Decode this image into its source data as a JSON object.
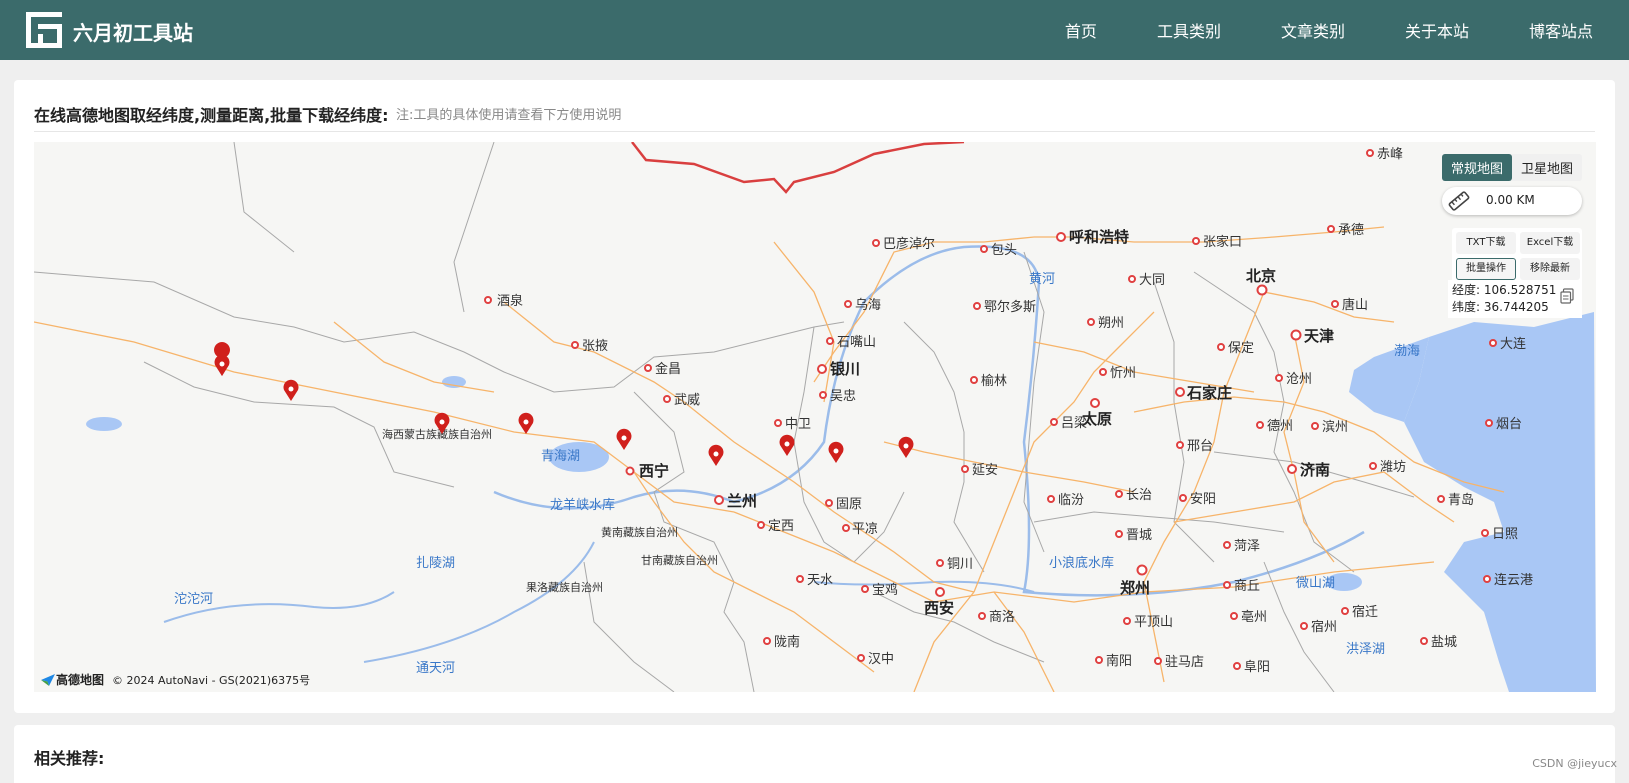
{
  "header": {
    "site_name": "六月初工具站",
    "nav": [
      "首页",
      "工具类别",
      "文章类别",
      "关于本站",
      "博客站点"
    ]
  },
  "tool": {
    "title": "在线高德地图取经纬度,测量距离,批量下载经纬度:",
    "note": "注:工具的具体使用请查看下方使用说明"
  },
  "map_controls": {
    "type_normal": "常规地图",
    "type_satellite": "卫星地图",
    "distance": "0.00 KM",
    "txt_download": "TXT下载",
    "excel_download": "Excel下载",
    "batch": "批量操作",
    "remove_latest": "移除最新",
    "lng_label": "经度:",
    "lng_value": "106.528751",
    "lat_label": "纬度:",
    "lat_value": "36.744205"
  },
  "map_labels": {
    "jiuquan": "酒泉",
    "zhangye": "张掖",
    "jinchang": "金昌",
    "wuwei": "武威",
    "xining": "西宁",
    "lanzhou": "兰州",
    "yinchuan": "银川",
    "wuzhong": "吴忠",
    "zhongwei": "中卫",
    "guyuan": "固原",
    "pingliang": "平凉",
    "dingxi": "定西",
    "tianshui": "天水",
    "baoji": "宝鸡",
    "xian": "西安",
    "tongchuan": "铜川",
    "yanan": "延安",
    "yulin": "榆林",
    "ordos": "鄂尔多斯",
    "baotou": "包头",
    "hohhot": "呼和浩特",
    "bayannur": "巴彦淖尔",
    "wuhai": "乌海",
    "shizuishan": "石嘴山",
    "datong": "大同",
    "shuozhou": "朔州",
    "xinzhou": "忻州",
    "taiyuan": "太原",
    "lvliang": "吕梁",
    "linfen": "临汾",
    "changzhi": "长治",
    "jincheng": "晋城",
    "zhangjiakou": "张家口",
    "chengde": "承德",
    "beijing": "北京",
    "tianjin": "天津",
    "tangshan": "唐山",
    "baoding": "保定",
    "cangzhou": "沧州",
    "shijiazhuang": "石家庄",
    "dezhou": "德州",
    "binzhou": "滨州",
    "jinan": "济南",
    "weifang": "潍坊",
    "qingdao": "青岛",
    "rizhao": "日照",
    "lianyungang": "连云港",
    "xingtai": "邢台",
    "anyang": "安阳",
    "heze": "菏泽",
    "shangqiu": "商丘",
    "zhengzhou": "郑州",
    "pingdingshan": "平顶山",
    "nanyang": "南阳",
    "zhumadian": "驻马店",
    "fuyang": "阜阳",
    "bozhou": "亳州",
    "suzhou": "宿州",
    "suqian": "宿迁",
    "yancheng": "盐城",
    "dalian": "大连",
    "yantai": "烟台",
    "shangluo": "商洛",
    "hanzhong": "汉中",
    "longnan": "陇南",
    "chifeng": "赤峰",
    "haixi": "海西蒙古族藏族自治州",
    "huangnan": "黄南藏族自治州",
    "gannan": "甘南藏族自治州",
    "guoluo": "果洛藏族自治州",
    "qinghai_lake": "青海湖",
    "longyangxia": "龙羊峡水库",
    "zhaling": "扎陵湖",
    "tuotuo": "沱沱河",
    "tongtian": "通天河",
    "yellow_river": "黄河",
    "bohai": "渤海",
    "xiaolangdi": "小浪底水库",
    "weishan": "微山湖",
    "hongze": "洪泽湖"
  },
  "attribution": {
    "logo_text": "高德地图",
    "copyright": "© 2024 AutoNavi - GS(2021)6375号"
  },
  "related": {
    "title": "相关推荐:"
  },
  "watermark": "CSDN @jieyucx",
  "colors": {
    "header_bg": "#3b6b6b",
    "marker": "#d0201c",
    "water": "#a9c7f5",
    "road": "#f7b46a",
    "border": "#d93f3f"
  },
  "icons": {
    "logo": "site-logo-icon",
    "ruler": "ruler-icon",
    "copy": "copy-icon",
    "marker": "map-marker-icon"
  }
}
